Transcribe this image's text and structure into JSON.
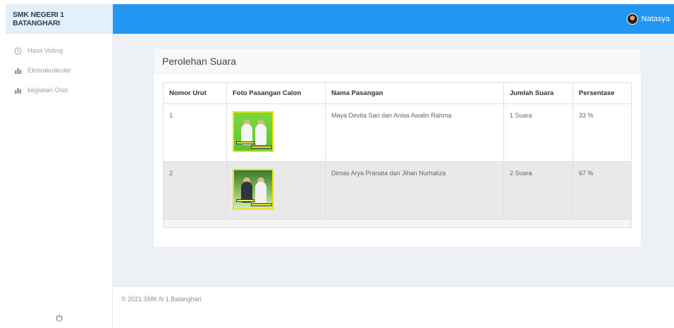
{
  "topbar": {
    "brand": "SMK NEGERI 1 BATANGHARI",
    "user_name": "Natasya",
    "color": "#2196f3"
  },
  "sidebar": {
    "items": [
      {
        "label": "Hasil Voting",
        "icon": "clock-icon"
      },
      {
        "label": "Ekstrakulikuler",
        "icon": "bar-chart-icon"
      },
      {
        "label": "kegiatan Osis",
        "icon": "bar-chart-icon"
      }
    ],
    "power_glyph": "⏻"
  },
  "card": {
    "title": "Perolehan Suara"
  },
  "table": {
    "headers": [
      "Nomor Urut",
      "Foto Pasangan Calon",
      "Nama Pasangan",
      "Jumlah Suara",
      "Persentase"
    ],
    "rows": [
      {
        "nomor": "1",
        "nama": "Maya Devita Sari dan Anisa Awalin Rahma",
        "jumlah": "1 Suara",
        "persen": "33 %"
      },
      {
        "nomor": "2",
        "nama": "Dimas Arya Pranata dan Jihan Nurhaliza",
        "jumlah": "2 Suara",
        "persen": "67 %"
      }
    ]
  },
  "footer": {
    "text": "© 2021 SMK N 1 Batanghari"
  }
}
